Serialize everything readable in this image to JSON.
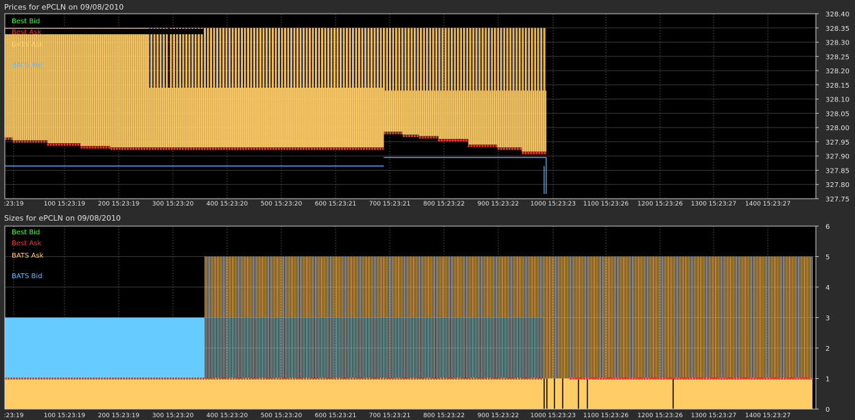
{
  "chart_data": [
    {
      "type": "line",
      "title": "Prices for  ePCLN  on  09/08/2010",
      "ylim": [
        327.75,
        328.4
      ],
      "y_ticks": [
        "328.40",
        "328.35",
        "328.30",
        "328.25",
        "328.20",
        "328.15",
        "328.10",
        "328.05",
        "328.00",
        "327.95",
        "327.90",
        "327.85",
        "327.80",
        "327.75"
      ],
      "x_ticks": [
        ":23:19",
        "100 15:23:19",
        "200 15:23:19",
        "300 15:23:20",
        "400 15:23:20",
        "500 15:23:20",
        "600 15:23:21",
        "700 15:23:21",
        "800 15:23:22",
        "900 15:23:22",
        "1000 15:23:23",
        "1100 15:23:26",
        "1200 15:23:26",
        "1300 15:23:27",
        "1400 15:23:27"
      ],
      "legend": [
        "Best Bid",
        "Best Ask",
        "BATS Ask",
        "BATS Bid"
      ],
      "legend_colors": [
        "#33ff33",
        "#ff2a2a",
        "#ffcc66",
        "#66bbff"
      ],
      "grid": true,
      "series": [
        {
          "name": "Best Ask",
          "segments": [
            [
              0,
              15,
              327.96
            ],
            [
              15,
              78,
              327.95
            ],
            [
              78,
              140,
              327.94
            ],
            [
              140,
              195,
              327.93
            ],
            [
              195,
              700,
              327.925
            ],
            [
              700,
              735,
              327.98
            ],
            [
              735,
              765,
              327.97
            ],
            [
              765,
              800,
              327.965
            ],
            [
              800,
              855,
              327.955
            ],
            [
              855,
              910,
              327.935
            ],
            [
              910,
              955,
              327.925
            ],
            [
              955,
              1000,
              327.91
            ]
          ]
        },
        {
          "name": "BATS Ask",
          "segments": [
            [
              0,
              265,
              328.35
            ],
            [
              265,
              1000,
              328.35
            ]
          ]
        },
        {
          "name": "BATS Bid",
          "segments": [
            [
              0,
              700,
              327.865
            ],
            [
              700,
              1000,
              327.895
            ]
          ]
        },
        {
          "name": "BATS Ask (lower level)",
          "segments": [
            [
              0,
              700,
              328.14
            ],
            [
              700,
              1000,
              328.13
            ]
          ]
        }
      ]
    },
    {
      "type": "line",
      "title": "Sizes for  ePCLN  on  09/08/2010",
      "ylim": [
        0,
        6
      ],
      "y_ticks": [
        "6",
        "5",
        "4",
        "3",
        "2",
        "1",
        "0"
      ],
      "x_ticks": [
        ":23:19",
        "100 15:23:19",
        "200 15:23:19",
        "300 15:23:20",
        "400 15:23:20",
        "500 15:23:20",
        "600 15:23:21",
        "700 15:23:21",
        "800 15:23:22",
        "900 15:23:22",
        "1000 15:23:23",
        "1100 15:23:26",
        "1200 15:23:26",
        "1300 15:23:27",
        "1400 15:23:27"
      ],
      "legend": [
        "Best Bid",
        "Best Ask",
        "BATS Ask",
        "BATS Bid"
      ],
      "legend_colors": [
        "#33ff33",
        "#ff2a2a",
        "#ffcc66",
        "#66bbff"
      ],
      "grid": true,
      "series": [
        {
          "name": "BATS Bid",
          "segments": [
            [
              0,
              250,
              3
            ],
            [
              250,
              700,
              3
            ]
          ]
        },
        {
          "name": "BATS Ask",
          "segments": [
            [
              250,
              1000,
              5
            ]
          ]
        },
        {
          "name": "Best Ask",
          "segments": [
            [
              0,
              700,
              1
            ],
            [
              700,
              1000,
              1
            ]
          ]
        }
      ]
    }
  ]
}
